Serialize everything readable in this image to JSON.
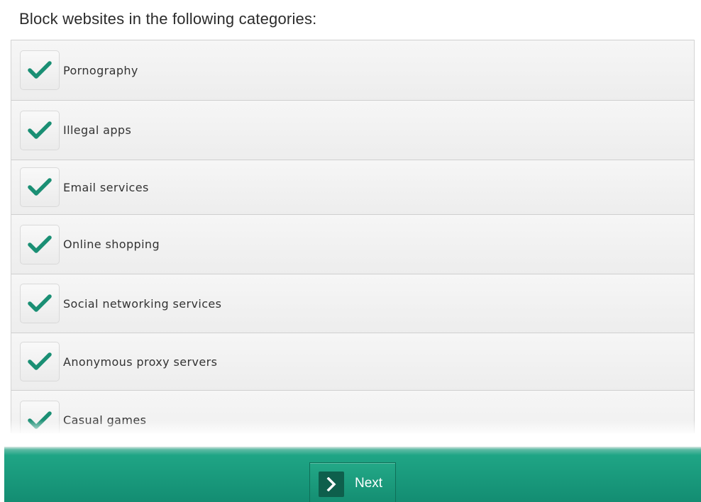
{
  "page": {
    "heading": "Block websites in the following categories:"
  },
  "categories": [
    {
      "label": "Pornography",
      "checked": true
    },
    {
      "label": "Illegal apps",
      "checked": true
    },
    {
      "label": "Email services",
      "checked": true
    },
    {
      "label": "Online shopping",
      "checked": true
    },
    {
      "label": "Social networking services",
      "checked": true
    },
    {
      "label": "Anonymous proxy servers",
      "checked": true
    },
    {
      "label": "Casual games",
      "checked": true
    }
  ],
  "footer": {
    "next_label": "Next",
    "next_icon": "chevron-right-icon"
  },
  "colors": {
    "accent": "#1a9b7b",
    "check": "#1a8f74",
    "footer_bg": "#138d72"
  }
}
